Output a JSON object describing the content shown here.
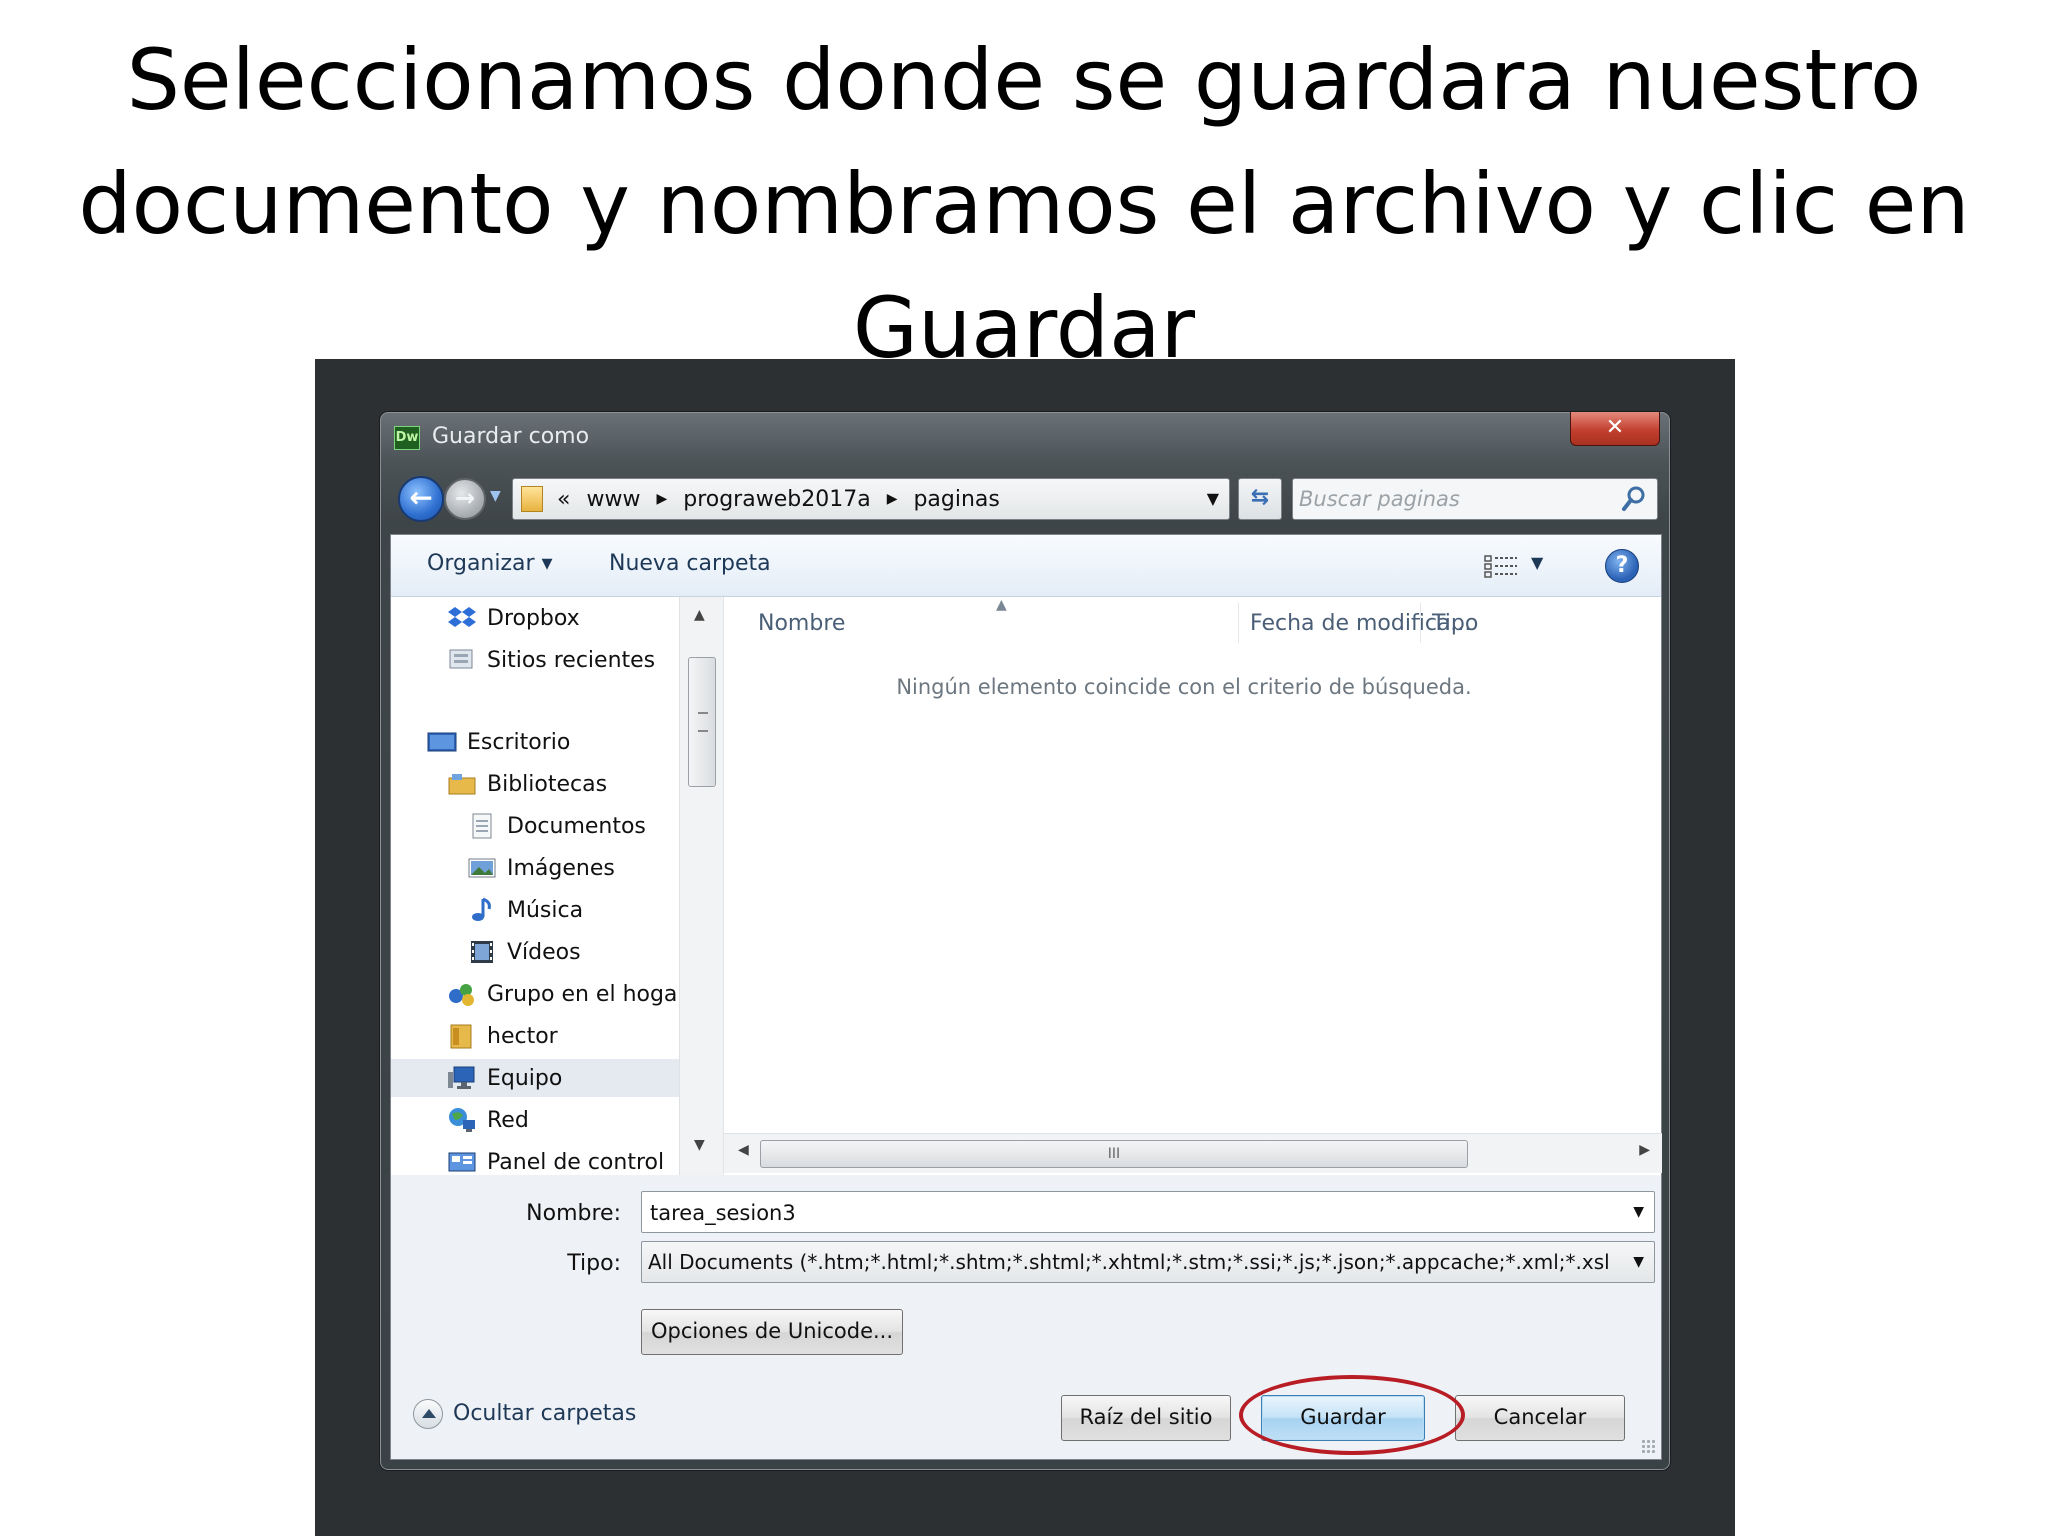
{
  "slide": {
    "title": "Seleccionamos donde se guardara nuestro documento y nombramos el archivo y clic en Guardar"
  },
  "window": {
    "app_icon_text": "Dw",
    "title": "Guardar como",
    "close_symbol": "✕"
  },
  "navigation": {
    "breadcrumbs": [
      "«",
      "www",
      "prograweb2017a",
      "paginas"
    ],
    "search_placeholder": "Buscar paginas"
  },
  "toolbar": {
    "organize": "Organizar ▾",
    "new_folder": "Nueva carpeta",
    "help_symbol": "?"
  },
  "sidebar": {
    "items": [
      {
        "label": "Dropbox",
        "icon": "dropbox-icon"
      },
      {
        "label": "Sitios recientes",
        "icon": "recent-places-icon"
      },
      {
        "label": "Escritorio",
        "icon": "desktop-icon"
      },
      {
        "label": "Bibliotecas",
        "icon": "libraries-icon"
      },
      {
        "label": "Documentos",
        "icon": "documents-icon"
      },
      {
        "label": "Imágenes",
        "icon": "pictures-icon"
      },
      {
        "label": "Música",
        "icon": "music-icon"
      },
      {
        "label": "Vídeos",
        "icon": "videos-icon"
      },
      {
        "label": "Grupo en el hoga",
        "icon": "homegroup-icon"
      },
      {
        "label": "hector",
        "icon": "user-folder-icon"
      },
      {
        "label": "Equipo",
        "icon": "computer-icon"
      },
      {
        "label": "Red",
        "icon": "network-icon"
      },
      {
        "label": "Panel de control",
        "icon": "control-panel-icon"
      }
    ],
    "selected": "Equipo"
  },
  "file_list": {
    "columns": [
      "Nombre",
      "Fecha de modifica...",
      "Tipo"
    ],
    "empty_message": "Ningún elemento coincide con el criterio de búsqueda.",
    "scroll_grip": "III"
  },
  "form": {
    "name_label": "Nombre:",
    "name_value": "tarea_sesion3",
    "type_label": "Tipo:",
    "type_value": "All Documents (*.htm;*.html;*.shtm;*.shtml;*.xhtml;*.stm;*.ssi;*.js;*.json;*.appcache;*.xml;*.xsl"
  },
  "buttons": {
    "unicode_options": "Opciones de Unicode...",
    "site_root": "Raíz del sitio",
    "save": "Guardar",
    "cancel": "Cancelar",
    "hide_folders": "Ocultar carpetas"
  },
  "colors": {
    "highlight": "#b81c24",
    "accent": "#2e6fd0"
  }
}
